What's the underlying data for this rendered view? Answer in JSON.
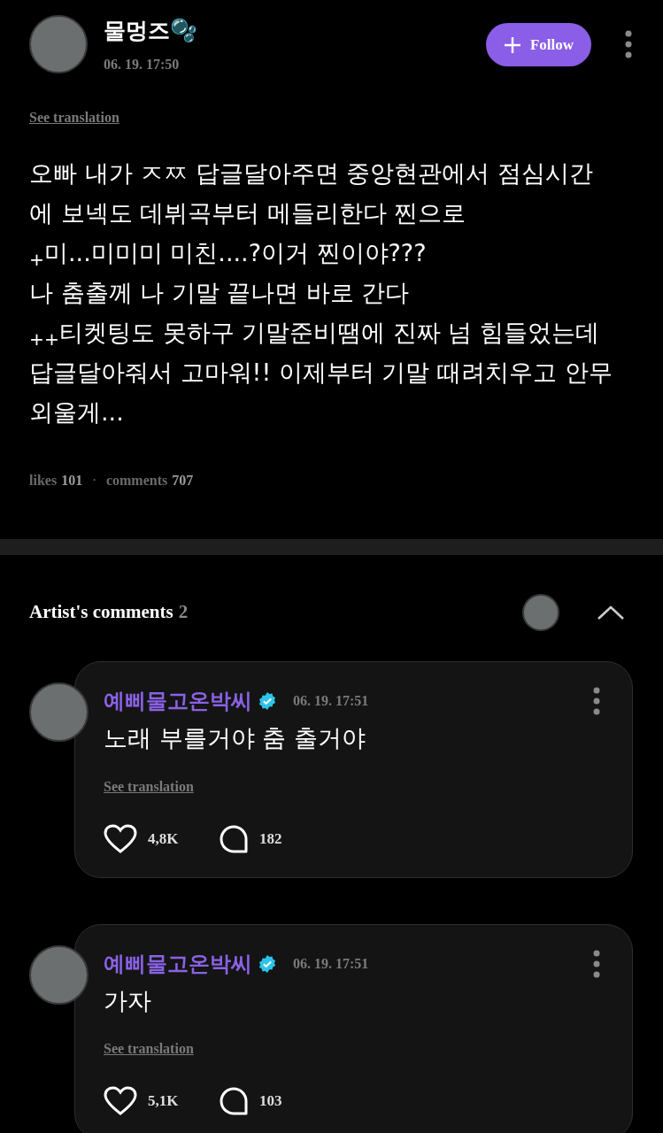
{
  "post": {
    "author": "물멍즈🫧",
    "time": "06. 19. 17:50",
    "follow_button": "Follow",
    "see_translation": "See translation",
    "body_lines": [
      "오빠 내가 ㅈㅉ 답글달아주면 중앙현관에서 점심시간",
      "에 보넥도 데뷔곡부터 메들리한다 찐으로",
      "$_{+}$미...미미미 미친....?이거 찐이야???",
      "나 춤출께 나 기말 끝나면 바로 간다",
      "$_{++}$티켓팅도 못하구 기말준비땜에 진짜 넘 힘들었는데",
      "답글달아줘서 고마워!! 이제부터 기말 때려치우고 안무",
      "외울게..."
    ],
    "likes_label": "likes",
    "likes": "101",
    "separator": "•",
    "comments_label": "comments",
    "comments": "707"
  },
  "artist_comments": {
    "title": "Artist's comments",
    "count": "2",
    "expanded": true,
    "items": [
      {
        "author": "예삐물고온박씨",
        "verified": true,
        "time": "06. 19. 17:51",
        "text": "노래 부를거야 춤 출거야",
        "see_translation": "See translation",
        "likes": "4,8K",
        "replies": "182"
      },
      {
        "author": "예삐물고온박씨",
        "verified": true,
        "time": "06. 19. 17:51",
        "text": "가자",
        "see_translation": "See translation",
        "likes": "5,1K",
        "replies": "103"
      }
    ]
  }
}
